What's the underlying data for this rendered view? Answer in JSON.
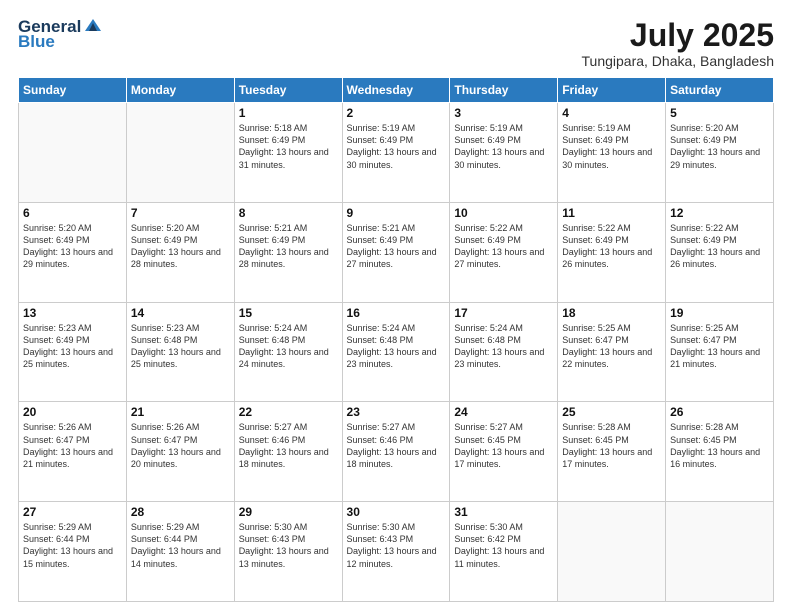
{
  "logo": {
    "line1": "General",
    "line2": "Blue"
  },
  "title": "July 2025",
  "location": "Tungipara, Dhaka, Bangladesh",
  "days_header": [
    "Sunday",
    "Monday",
    "Tuesday",
    "Wednesday",
    "Thursday",
    "Friday",
    "Saturday"
  ],
  "weeks": [
    [
      {
        "day": "",
        "info": ""
      },
      {
        "day": "",
        "info": ""
      },
      {
        "day": "1",
        "info": "Sunrise: 5:18 AM\nSunset: 6:49 PM\nDaylight: 13 hours and 31 minutes."
      },
      {
        "day": "2",
        "info": "Sunrise: 5:19 AM\nSunset: 6:49 PM\nDaylight: 13 hours and 30 minutes."
      },
      {
        "day": "3",
        "info": "Sunrise: 5:19 AM\nSunset: 6:49 PM\nDaylight: 13 hours and 30 minutes."
      },
      {
        "day": "4",
        "info": "Sunrise: 5:19 AM\nSunset: 6:49 PM\nDaylight: 13 hours and 30 minutes."
      },
      {
        "day": "5",
        "info": "Sunrise: 5:20 AM\nSunset: 6:49 PM\nDaylight: 13 hours and 29 minutes."
      }
    ],
    [
      {
        "day": "6",
        "info": "Sunrise: 5:20 AM\nSunset: 6:49 PM\nDaylight: 13 hours and 29 minutes."
      },
      {
        "day": "7",
        "info": "Sunrise: 5:20 AM\nSunset: 6:49 PM\nDaylight: 13 hours and 28 minutes."
      },
      {
        "day": "8",
        "info": "Sunrise: 5:21 AM\nSunset: 6:49 PM\nDaylight: 13 hours and 28 minutes."
      },
      {
        "day": "9",
        "info": "Sunrise: 5:21 AM\nSunset: 6:49 PM\nDaylight: 13 hours and 27 minutes."
      },
      {
        "day": "10",
        "info": "Sunrise: 5:22 AM\nSunset: 6:49 PM\nDaylight: 13 hours and 27 minutes."
      },
      {
        "day": "11",
        "info": "Sunrise: 5:22 AM\nSunset: 6:49 PM\nDaylight: 13 hours and 26 minutes."
      },
      {
        "day": "12",
        "info": "Sunrise: 5:22 AM\nSunset: 6:49 PM\nDaylight: 13 hours and 26 minutes."
      }
    ],
    [
      {
        "day": "13",
        "info": "Sunrise: 5:23 AM\nSunset: 6:49 PM\nDaylight: 13 hours and 25 minutes."
      },
      {
        "day": "14",
        "info": "Sunrise: 5:23 AM\nSunset: 6:48 PM\nDaylight: 13 hours and 25 minutes."
      },
      {
        "day": "15",
        "info": "Sunrise: 5:24 AM\nSunset: 6:48 PM\nDaylight: 13 hours and 24 minutes."
      },
      {
        "day": "16",
        "info": "Sunrise: 5:24 AM\nSunset: 6:48 PM\nDaylight: 13 hours and 23 minutes."
      },
      {
        "day": "17",
        "info": "Sunrise: 5:24 AM\nSunset: 6:48 PM\nDaylight: 13 hours and 23 minutes."
      },
      {
        "day": "18",
        "info": "Sunrise: 5:25 AM\nSunset: 6:47 PM\nDaylight: 13 hours and 22 minutes."
      },
      {
        "day": "19",
        "info": "Sunrise: 5:25 AM\nSunset: 6:47 PM\nDaylight: 13 hours and 21 minutes."
      }
    ],
    [
      {
        "day": "20",
        "info": "Sunrise: 5:26 AM\nSunset: 6:47 PM\nDaylight: 13 hours and 21 minutes."
      },
      {
        "day": "21",
        "info": "Sunrise: 5:26 AM\nSunset: 6:47 PM\nDaylight: 13 hours and 20 minutes."
      },
      {
        "day": "22",
        "info": "Sunrise: 5:27 AM\nSunset: 6:46 PM\nDaylight: 13 hours and 18 minutes."
      },
      {
        "day": "23",
        "info": "Sunrise: 5:27 AM\nSunset: 6:46 PM\nDaylight: 13 hours and 18 minutes."
      },
      {
        "day": "24",
        "info": "Sunrise: 5:27 AM\nSunset: 6:45 PM\nDaylight: 13 hours and 17 minutes."
      },
      {
        "day": "25",
        "info": "Sunrise: 5:28 AM\nSunset: 6:45 PM\nDaylight: 13 hours and 17 minutes."
      },
      {
        "day": "26",
        "info": "Sunrise: 5:28 AM\nSunset: 6:45 PM\nDaylight: 13 hours and 16 minutes."
      }
    ],
    [
      {
        "day": "27",
        "info": "Sunrise: 5:29 AM\nSunset: 6:44 PM\nDaylight: 13 hours and 15 minutes."
      },
      {
        "day": "28",
        "info": "Sunrise: 5:29 AM\nSunset: 6:44 PM\nDaylight: 13 hours and 14 minutes."
      },
      {
        "day": "29",
        "info": "Sunrise: 5:30 AM\nSunset: 6:43 PM\nDaylight: 13 hours and 13 minutes."
      },
      {
        "day": "30",
        "info": "Sunrise: 5:30 AM\nSunset: 6:43 PM\nDaylight: 13 hours and 12 minutes."
      },
      {
        "day": "31",
        "info": "Sunrise: 5:30 AM\nSunset: 6:42 PM\nDaylight: 13 hours and 11 minutes."
      },
      {
        "day": "",
        "info": ""
      },
      {
        "day": "",
        "info": ""
      }
    ]
  ]
}
